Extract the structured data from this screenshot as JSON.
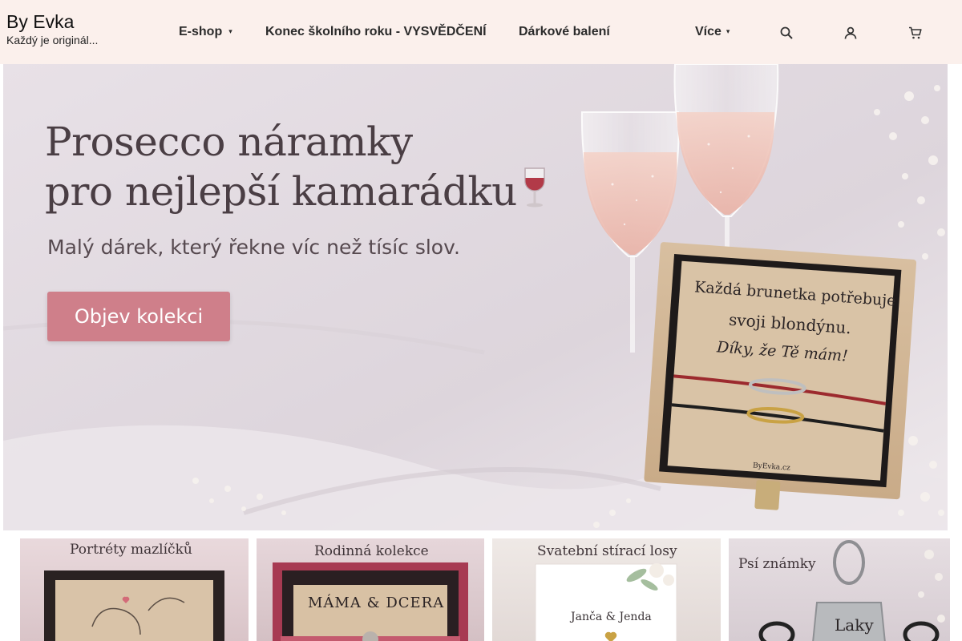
{
  "brand": {
    "name": "By Evka",
    "tagline": "Každý je originál..."
  },
  "nav": {
    "eshop": "E-shop",
    "school": "Konec školního roku - VYSVĚDČENÍ",
    "gift": "Dárkové balení",
    "more": "Více"
  },
  "icons": [
    "search-icon",
    "user-icon",
    "cart-icon"
  ],
  "hero": {
    "title_line1": "Prosecco náramky",
    "title_line2": "pro nejlepší kamarádku",
    "subtitle": "Malý dárek, který řekne víc než tísíc slov.",
    "cta": "Objev kolekci",
    "box_line1": "Každá brunetka potřebuje",
    "box_line2": "svoji blondýnu.",
    "box_line3": "Díky, že Tě mám!",
    "box_brand": "ByEvka.cz"
  },
  "tiles": [
    {
      "title": "Portréty mazlíčků"
    },
    {
      "title": "Rodinná kolekce",
      "card_text": "MÁMA & DCERA"
    },
    {
      "title": "Svatební stírací losy",
      "card_text": "Janča & Jenda"
    },
    {
      "title": "Psí známky",
      "tag_text": "Laky"
    }
  ],
  "colors": {
    "header_bg": "#fbf0ec",
    "cta": "#cf7f8a"
  }
}
